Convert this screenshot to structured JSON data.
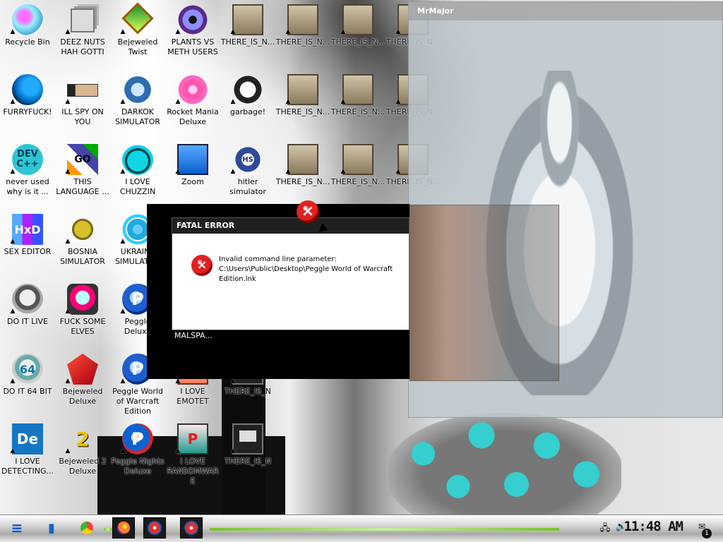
{
  "desktop": {
    "icons": [
      {
        "label": "Recycle Bin",
        "type": "recycle"
      },
      {
        "label": "DEEZ NUTS HAH GOTTI",
        "type": "stack"
      },
      {
        "label": "Bejeweled Twist",
        "type": "gem-green"
      },
      {
        "label": "PLANTS VS METH USERS",
        "type": "flower"
      },
      {
        "label": "THERE_IS_N...",
        "type": "folder"
      },
      {
        "label": "THERE_IS_N...",
        "type": "folder"
      },
      {
        "label": "THERE_IS_N...",
        "type": "folder"
      },
      {
        "label": "THERE_IS_N...",
        "type": "folder"
      },
      {
        "label": "FURRYFUCK!",
        "type": "firefox"
      },
      {
        "label": "ILL SPY ON YOU",
        "type": "spy"
      },
      {
        "label": "DARKOK SIMULATOR",
        "type": "dollar"
      },
      {
        "label": "Rocket Mania Deluxe",
        "type": "rocket"
      },
      {
        "label": "garbage!",
        "type": "garbage"
      },
      {
        "label": "THERE_IS_N...",
        "type": "folder"
      },
      {
        "label": "THERE_IS_N...",
        "type": "folder"
      },
      {
        "label": "THERE_IS_N...",
        "type": "folder"
      },
      {
        "label": "never used why is it ...",
        "type": "dev"
      },
      {
        "label": "THIS LANGUAGE ...",
        "type": "go"
      },
      {
        "label": "I LOVE CHUZZIN",
        "type": "fuzzy"
      },
      {
        "label": "Zoom",
        "type": "zoom"
      },
      {
        "label": "hitler simulator",
        "type": "hitler"
      },
      {
        "label": "THERE_IS_N...",
        "type": "folder"
      },
      {
        "label": "THERE_IS_N...",
        "type": "folder"
      },
      {
        "label": "THERE_IS_N...",
        "type": "folder"
      },
      {
        "label": "SEX EDITOR",
        "type": "hex"
      },
      {
        "label": "BOSNIA SIMULATOR",
        "type": "bosnia"
      },
      {
        "label": "UKRAINE SIMULATOR",
        "type": "ukraine"
      },
      {
        "label": "DO IT LIVE",
        "type": "face"
      },
      {
        "label": "FUCK SOME ELVES",
        "type": "elves"
      },
      {
        "label": "Peggle Deluxe",
        "type": "peggle"
      },
      {
        "label": "DO IT 64 BIT",
        "type": "face64"
      },
      {
        "label": "Bejeweled Deluxe",
        "type": "ruby"
      },
      {
        "label": "Peggle World of Warcraft Edition",
        "type": "peggle"
      },
      {
        "label": "I LOVE EMOTET",
        "type": "ppt"
      },
      {
        "label": "THERE_IS_N",
        "type": "monitor"
      },
      {
        "label": "I LOVE DETECTING...",
        "type": "de"
      },
      {
        "label": "Bejeweled 2 Deluxe",
        "type": "two"
      },
      {
        "label": "Peggle Nights Deluxe",
        "type": "peggle-red"
      },
      {
        "label": "I LOVE RANSOMWARE",
        "type": "pub"
      },
      {
        "label": "THERE_IS_N",
        "type": "monitor"
      }
    ],
    "overlay_label": "MALSPA..."
  },
  "overlay_window": {
    "title": "MrMajor"
  },
  "fatal_error": {
    "title": "FATAL ERROR",
    "message": "Invalid command line parameter: C:\\Users\\Public\\Desktop\\Peggle World of Warcraft Edition.lnk"
  },
  "taskbar": {
    "clock": "11:48 AM",
    "notifications": "1"
  }
}
